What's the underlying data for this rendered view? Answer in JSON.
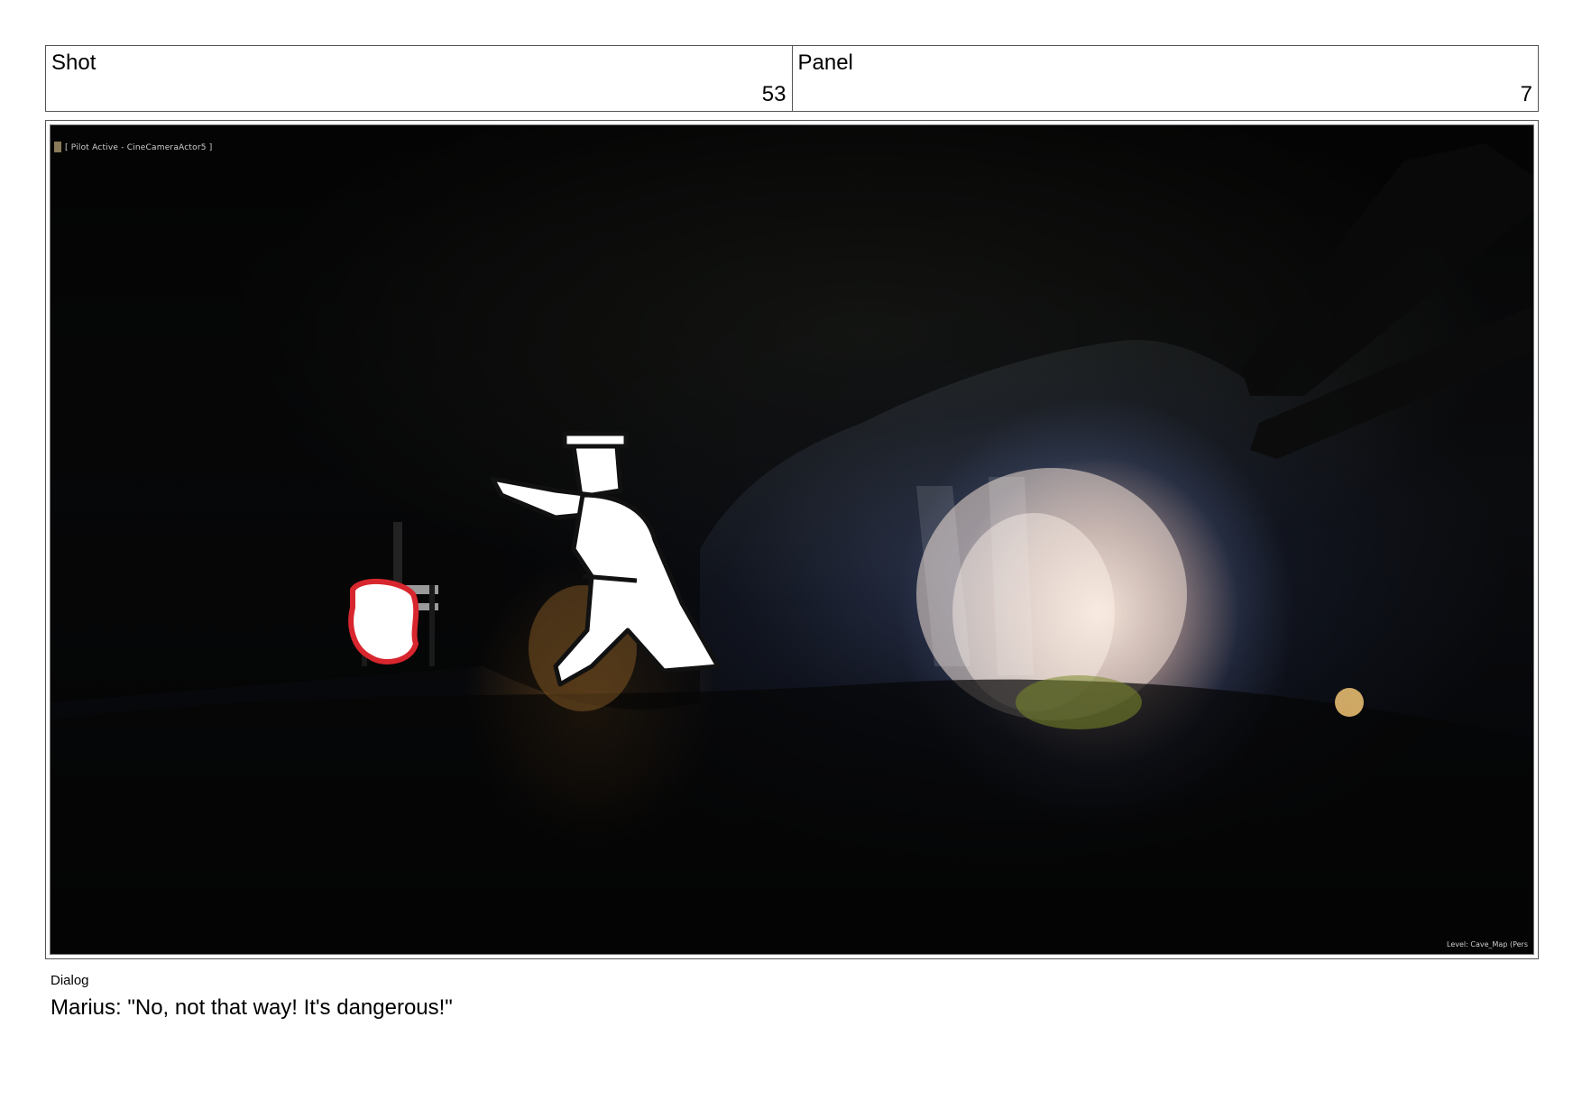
{
  "header": {
    "shot_label": "Shot",
    "shot_number": "53",
    "panel_label": "Panel",
    "panel_number": "7"
  },
  "frame": {
    "hud_top_text": "[ Pilot Active - CineCameraActor5 ]",
    "hud_bottom_text": "Level: Cave_Map (Pers",
    "scene_colors": {
      "cave_dark": "#050505",
      "light_opening": "#f6e6dc",
      "torch_glow": "#c88a3a",
      "sketch_red": "#d8262e"
    }
  },
  "dialog": {
    "label": "Dialog",
    "text": "Marius: \"No, not that way! It's dangerous!\""
  }
}
